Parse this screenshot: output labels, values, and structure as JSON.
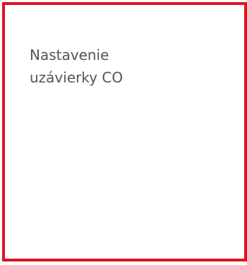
{
  "tile": {
    "title_line1": "Nastavenie",
    "title_line2": "uzávierky CO"
  },
  "colors": {
    "tile_border": "#e3111b",
    "title_text": "#555555",
    "background": "#ffffff"
  }
}
